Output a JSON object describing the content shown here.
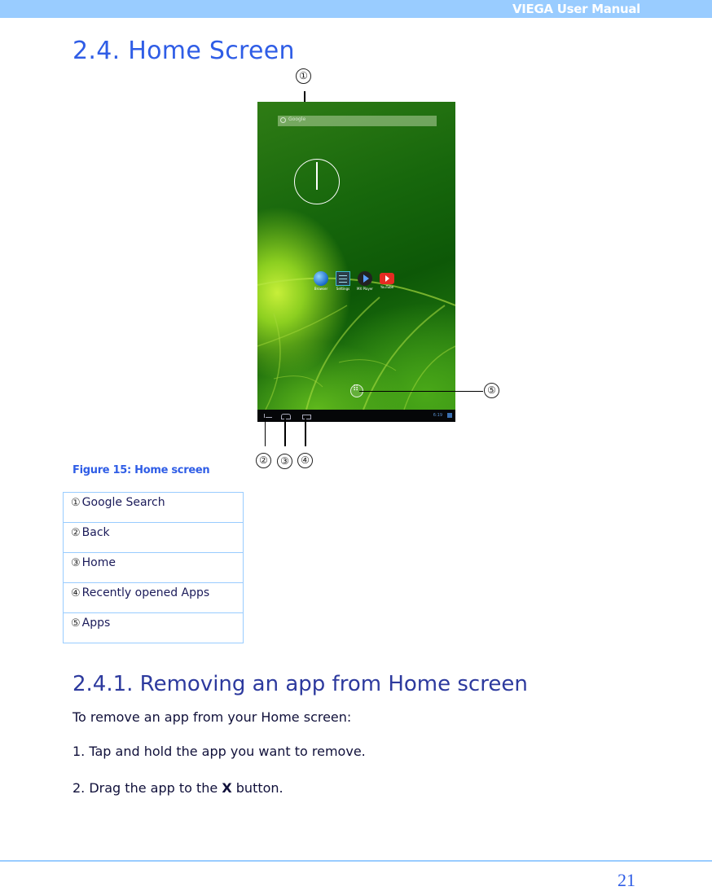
{
  "header": {
    "title": "VIEGA User Manual",
    "bar_color": "#99ccff"
  },
  "section": {
    "title": "2.4. Home Screen"
  },
  "figure": {
    "caption": "Figure 15: Home screen",
    "callouts": [
      "①",
      "②",
      "③",
      "④",
      "⑤"
    ],
    "screenshot": {
      "search_placeholder": "Google",
      "apps": [
        {
          "label": "Browser",
          "icon": "globe-icon"
        },
        {
          "label": "Settings",
          "icon": "settings-sliders-icon"
        },
        {
          "label": "MX Player",
          "icon": "play-icon"
        },
        {
          "label": "YouTube",
          "icon": "youtube-icon"
        }
      ],
      "status_time": "6:19"
    }
  },
  "legend": [
    {
      "num": "①",
      "label": "Google Search"
    },
    {
      "num": "②",
      "label": "Back"
    },
    {
      "num": "③",
      "label": "Home"
    },
    {
      "num": "④",
      "label": "Recently opened Apps"
    },
    {
      "num": "⑤",
      "label": "Apps"
    }
  ],
  "subsection": {
    "title": "2.4.1. Removing an app from Home screen",
    "intro": "To remove an app from your Home screen:",
    "step1": "1. Tap and hold the app you want to remove.",
    "step2_prefix": "2. Drag the app to the ",
    "step2_bold": "X",
    "step2_suffix": " button."
  },
  "footer": {
    "page_number": "21"
  }
}
